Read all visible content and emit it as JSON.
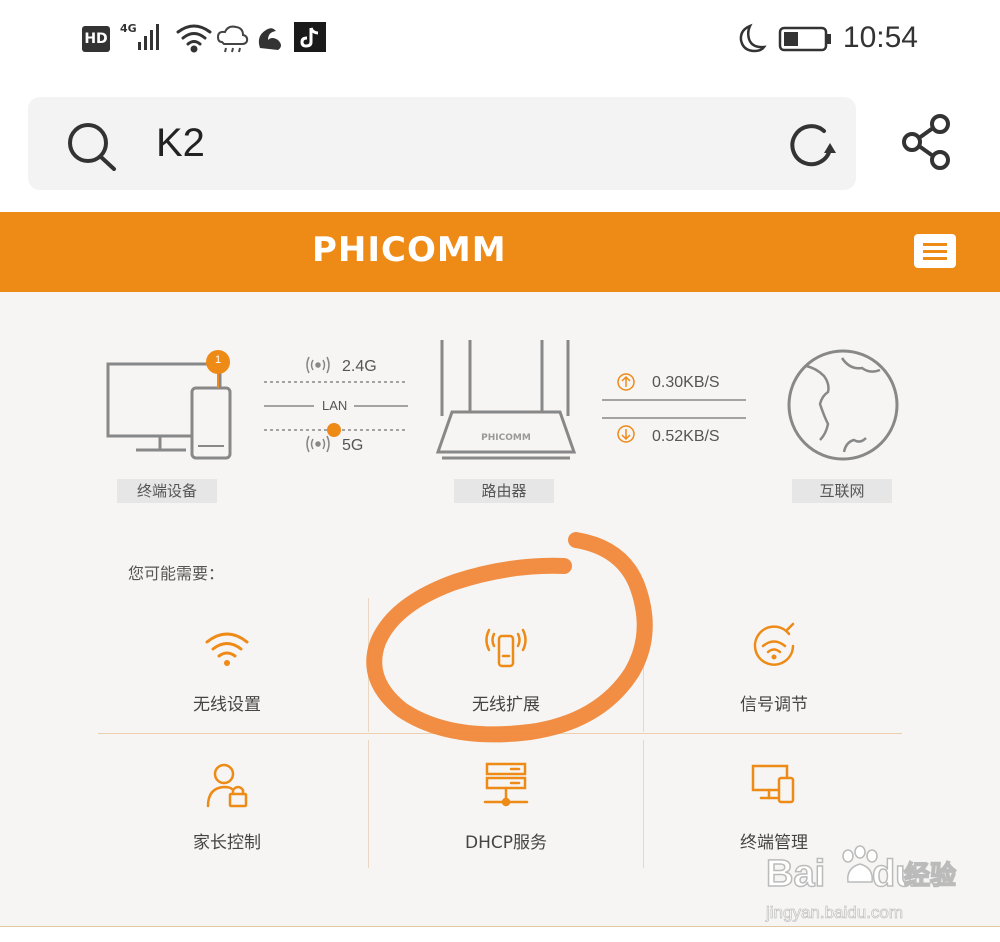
{
  "status_bar": {
    "hd_badge": "HD",
    "network": "4G",
    "time": "10:54",
    "icons": [
      "signal-icon",
      "wifi-icon",
      "cloud-icon",
      "uc-browser-icon",
      "tiktok-icon",
      "moon-icon",
      "battery-icon"
    ]
  },
  "search": {
    "query": "K2"
  },
  "header": {
    "brand": "PHICOMM"
  },
  "topology": {
    "device_badge": "1",
    "band_24": "2.4G",
    "lan": "LAN",
    "band_5": "5G",
    "router_brand": "PHICOMM",
    "upload_speed": "0.30KB/S",
    "download_speed": "0.52KB/S",
    "captions": {
      "devices": "终端设备",
      "router": "路由器",
      "internet": "互联网"
    }
  },
  "suggest": {
    "title": "您可能需要：",
    "items": [
      {
        "label": "无线设置",
        "icon": "wifi-icon"
      },
      {
        "label": "无线扩展",
        "icon": "wireless-extender-icon"
      },
      {
        "label": "信号调节",
        "icon": "signal-adjust-icon"
      },
      {
        "label": "家长控制",
        "icon": "parental-control-icon"
      },
      {
        "label": "DHCP服务",
        "icon": "server-icon"
      },
      {
        "label": "终端管理",
        "icon": "device-management-icon"
      }
    ]
  },
  "watermark": {
    "brand": "Bai",
    "brand2": "du",
    "product": "经验",
    "url": "jingyan.baidu.com"
  },
  "colors": {
    "accent": "#ee8a16",
    "annotation": "#f0883a",
    "content_bg": "#f6f5f3",
    "search_bg": "#f3f3f3"
  }
}
